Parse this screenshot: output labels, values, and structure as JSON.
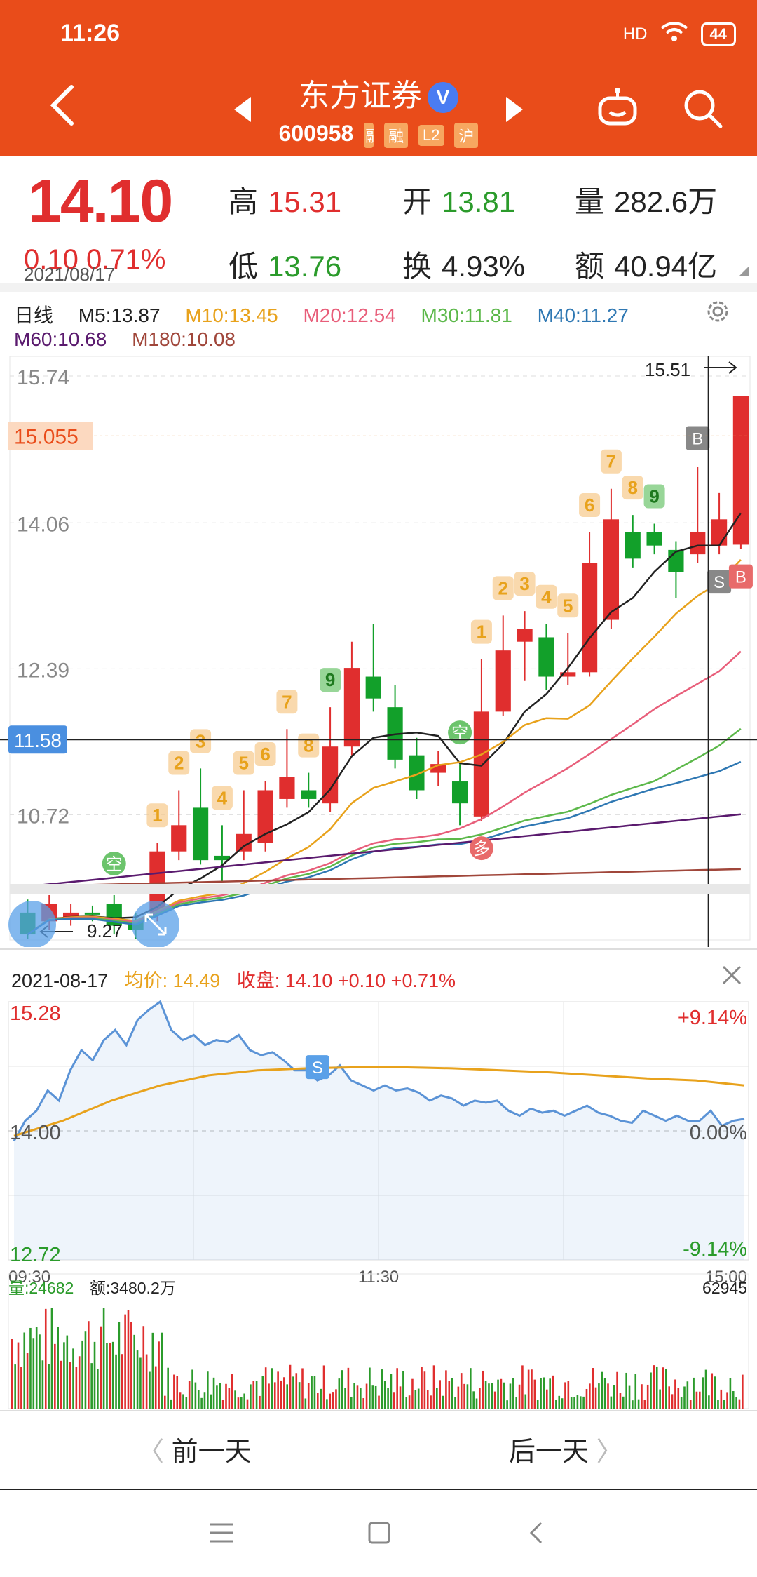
{
  "status_bar": {
    "time": "11:26",
    "network": "HD",
    "battery": "44"
  },
  "header": {
    "stock_name": "东方证券",
    "verified_badge": "V",
    "code": "600958",
    "tags": [
      "融",
      "L2",
      "沪"
    ],
    "partial_tag": "融"
  },
  "quote": {
    "price": "14.10",
    "change": "0.10  0.71%",
    "date": "2021/08/17",
    "high_label": "高",
    "high": "15.31",
    "open_label": "开",
    "open": "13.81",
    "volume_label": "量",
    "volume": "282.6万",
    "low_label": "低",
    "low": "13.76",
    "turnover_label": "换",
    "turnover": "4.93%",
    "amount_label": "额",
    "amount": "40.94亿"
  },
  "ma_legend": {
    "period": "日线",
    "items": [
      {
        "label": "M5:13.87",
        "color": "#222222"
      },
      {
        "label": "M10:13.45",
        "color": "#e8a21c"
      },
      {
        "label": "M20:12.54",
        "color": "#e85e7a"
      },
      {
        "label": "M30:11.81",
        "color": "#5cb84a"
      },
      {
        "label": "M40:11.27",
        "color": "#2f78b3"
      },
      {
        "label": "M60:10.68",
        "color": "#5a1a6e"
      },
      {
        "label": "M180:10.08",
        "color": "#a0463a"
      }
    ]
  },
  "colors": {
    "up": "#e02e2e",
    "down": "#12a02a",
    "accent": "#e94c1a",
    "avg_line": "#e8a21c",
    "price_line": "#5b93d6"
  },
  "chart_data": [
    {
      "type": "candlestick",
      "title": "日线",
      "y_ticks": [
        "15.74",
        "14.06",
        "12.39",
        "10.72"
      ],
      "ylim": [
        9.27,
        15.74
      ],
      "crosshair_price": "11.58",
      "dashed_level": "15.055",
      "max_label": "15.51",
      "min_label": "9.27",
      "candles": [
        {
          "o": 9.6,
          "c": 9.35,
          "h": 9.75,
          "l": 9.3
        },
        {
          "o": 9.5,
          "c": 9.7,
          "h": 9.8,
          "l": 9.4
        },
        {
          "o": 9.55,
          "c": 9.6,
          "h": 9.7,
          "l": 9.45
        },
        {
          "o": 9.6,
          "c": 9.58,
          "h": 9.68,
          "l": 9.5
        },
        {
          "o": 9.7,
          "c": 9.45,
          "h": 9.8,
          "l": 9.35
        },
        {
          "o": 9.5,
          "c": 9.4,
          "h": 9.6,
          "l": 9.3
        },
        {
          "o": 9.6,
          "c": 10.3,
          "h": 10.4,
          "l": 9.5
        },
        {
          "o": 10.3,
          "c": 10.6,
          "h": 11.0,
          "l": 10.2
        },
        {
          "o": 10.8,
          "c": 10.2,
          "h": 11.25,
          "l": 10.15
        },
        {
          "o": 10.25,
          "c": 10.2,
          "h": 10.6,
          "l": 9.95
        },
        {
          "o": 10.3,
          "c": 10.5,
          "h": 11.0,
          "l": 10.2
        },
        {
          "o": 10.4,
          "c": 11.0,
          "h": 11.1,
          "l": 10.3
        },
        {
          "o": 10.9,
          "c": 11.15,
          "h": 11.7,
          "l": 10.8
        },
        {
          "o": 11.0,
          "c": 10.9,
          "h": 11.2,
          "l": 10.8
        },
        {
          "o": 10.85,
          "c": 11.5,
          "h": 11.95,
          "l": 10.75
        },
        {
          "o": 11.5,
          "c": 12.4,
          "h": 12.7,
          "l": 11.4
        },
        {
          "o": 12.3,
          "c": 12.05,
          "h": 12.9,
          "l": 11.9
        },
        {
          "o": 11.95,
          "c": 11.35,
          "h": 12.2,
          "l": 11.25
        },
        {
          "o": 11.4,
          "c": 11.0,
          "h": 11.6,
          "l": 10.9
        },
        {
          "o": 11.2,
          "c": 11.3,
          "h": 11.45,
          "l": 11.05
        },
        {
          "o": 11.1,
          "c": 10.85,
          "h": 11.3,
          "l": 10.6
        },
        {
          "o": 10.7,
          "c": 11.9,
          "h": 12.5,
          "l": 10.65
        },
        {
          "o": 11.9,
          "c": 12.6,
          "h": 13.0,
          "l": 11.85
        },
        {
          "o": 12.7,
          "c": 12.85,
          "h": 13.05,
          "l": 12.25
        },
        {
          "o": 12.75,
          "c": 12.3,
          "h": 12.9,
          "l": 12.15
        },
        {
          "o": 12.3,
          "c": 12.35,
          "h": 12.8,
          "l": 12.2
        },
        {
          "o": 12.35,
          "c": 13.6,
          "h": 13.95,
          "l": 12.3
        },
        {
          "o": 12.95,
          "c": 14.1,
          "h": 14.45,
          "l": 12.85
        },
        {
          "o": 13.95,
          "c": 13.65,
          "h": 14.15,
          "l": 13.55
        },
        {
          "o": 13.95,
          "c": 13.8,
          "h": 14.05,
          "l": 13.7
        },
        {
          "o": 13.75,
          "c": 13.5,
          "h": 13.85,
          "l": 13.2
        },
        {
          "o": 13.7,
          "c": 13.95,
          "h": 14.7,
          "l": 13.6
        },
        {
          "o": 13.8,
          "c": 14.1,
          "h": 14.4,
          "l": 13.7
        },
        {
          "o": 13.81,
          "c": 15.51,
          "h": 15.51,
          "l": 13.76
        }
      ],
      "td_labels": [
        {
          "i": 6,
          "t": "1"
        },
        {
          "i": 7,
          "t": "2"
        },
        {
          "i": 8,
          "t": "3"
        },
        {
          "i": 9,
          "t": "4"
        },
        {
          "i": 10,
          "t": "5"
        },
        {
          "i": 11,
          "t": "6"
        },
        {
          "i": 12,
          "t": "7"
        },
        {
          "i": 13,
          "t": "8"
        },
        {
          "i": 14,
          "t": "9"
        },
        {
          "i": 21,
          "t": "1"
        },
        {
          "i": 22,
          "t": "2"
        },
        {
          "i": 23,
          "t": "3"
        },
        {
          "i": 24,
          "t": "4"
        },
        {
          "i": 25,
          "t": "5"
        },
        {
          "i": 26,
          "t": "6"
        },
        {
          "i": 27,
          "t": "7"
        },
        {
          "i": 28,
          "t": "8"
        },
        {
          "i": 29,
          "t": "9"
        }
      ],
      "signals": [
        {
          "i": 4,
          "t": "空"
        },
        {
          "i": 20,
          "t": "空"
        },
        {
          "i": 21,
          "t": "多"
        },
        {
          "i": 31,
          "t": "B"
        },
        {
          "i": 32,
          "t": "S"
        },
        {
          "i": 33,
          "t": "B"
        }
      ]
    },
    {
      "type": "line",
      "title": "分时",
      "date": "2021-08-17",
      "avg_label": "均价:",
      "avg": "14.49",
      "close_label": "收盘:",
      "close": "14.10 +0.10 +0.71%",
      "y_left": [
        "15.28",
        "14.00",
        "12.72"
      ],
      "y_right": [
        "+9.14%",
        "0.00%",
        "-9.14%"
      ],
      "x_ticks": [
        "09:30",
        "11:30",
        "15:00"
      ],
      "ylim": [
        12.72,
        15.28
      ],
      "signal": "S",
      "price": [
        13.9,
        14.1,
        14.2,
        14.4,
        14.3,
        14.6,
        14.8,
        14.7,
        14.9,
        15.0,
        14.85,
        15.1,
        15.2,
        15.28,
        15.0,
        14.9,
        14.95,
        14.85,
        14.9,
        14.88,
        14.95,
        14.8,
        14.75,
        14.78,
        14.7,
        14.6,
        14.6,
        14.5,
        14.55,
        14.65,
        14.5,
        14.45,
        14.4,
        14.45,
        14.4,
        14.42,
        14.38,
        14.3,
        14.35,
        14.32,
        14.25,
        14.3,
        14.28,
        14.3,
        14.2,
        14.15,
        14.22,
        14.18,
        14.2,
        14.15,
        14.2,
        14.25,
        14.18,
        14.15,
        14.1,
        14.08,
        14.2,
        14.15,
        14.1,
        14.15,
        14.1,
        14.1,
        14.2,
        14.05,
        14.1,
        14.12
      ],
      "avg_price": [
        13.95,
        14.1,
        14.3,
        14.45,
        14.55,
        14.6,
        14.62,
        14.63,
        14.63,
        14.62,
        14.6,
        14.58,
        14.55,
        14.52,
        14.5,
        14.45
      ],
      "volume_label": "量:",
      "volume": "24682",
      "amount_label": "额:",
      "amount": "3480.2万",
      "vol_max": "62945"
    }
  ],
  "day_nav": {
    "prev": "前一天",
    "next": "后一天"
  },
  "system_nav": [
    "menu",
    "home",
    "back"
  ]
}
